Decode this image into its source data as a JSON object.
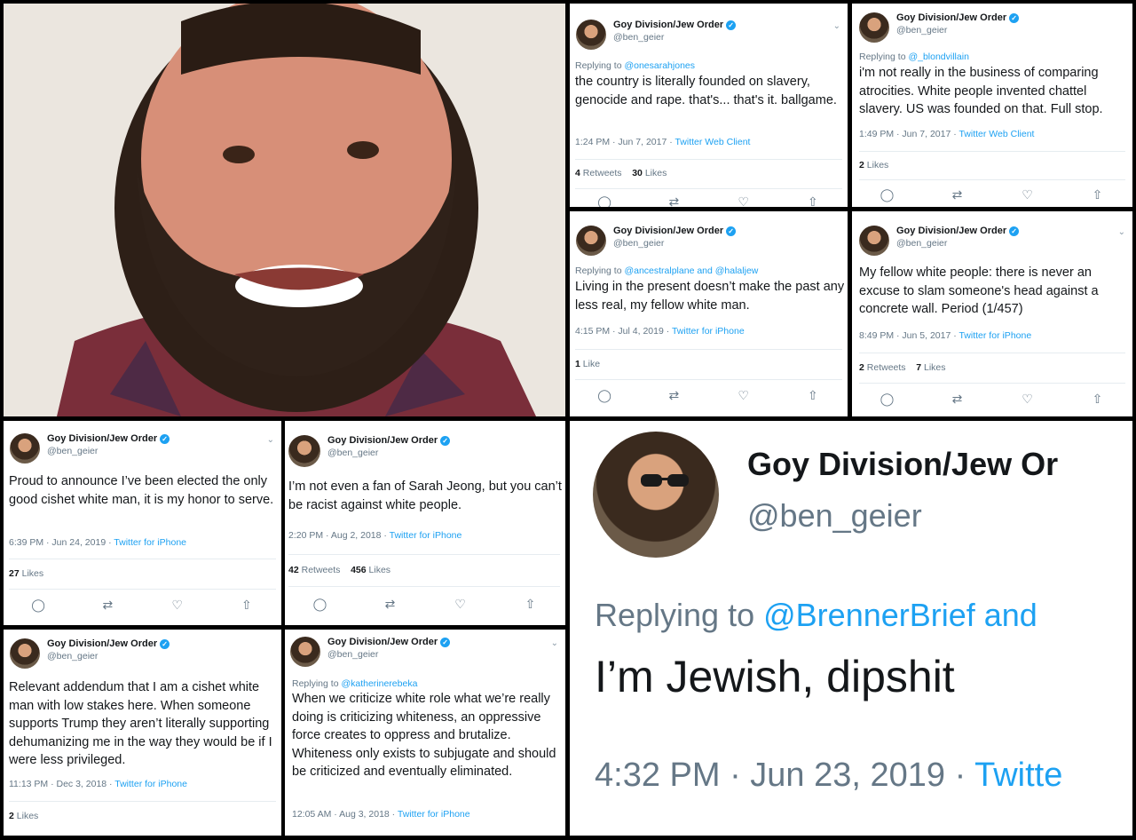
{
  "account": {
    "display_name": "Goy Division/Jew Order",
    "handle": "@ben_geier",
    "verified_glyph": "✓"
  },
  "icons": {
    "reply": "comment-bubble-icon",
    "retweet": "retweet-icon",
    "like": "heart-icon",
    "share": "share-icon",
    "more": "chevron-down-icon"
  },
  "tweets": [
    {
      "replying_label": "Replying to",
      "replying_to": "@onesarahjones",
      "text": "the country is literally founded on slavery, genocide and rape. that's... that's it. ballgame.",
      "time": "1:24 PM · Jun 7, 2017 · ",
      "source": "Twitter Web Client",
      "retweets": "4",
      "retweets_label": "Retweets",
      "likes": "30",
      "likes_label": "Likes"
    },
    {
      "replying_label": "Replying to",
      "replying_to": "@_blondvillain",
      "text": "i'm not really in the business of comparing atrocities. White people invented chattel slavery. US was founded on that. Full stop.",
      "time": "1:49 PM · Jun 7, 2017 · ",
      "source": "Twitter Web Client",
      "likes": "2",
      "likes_label": "Likes"
    },
    {
      "replying_label": "Replying to",
      "replying_to": "@ancestralplane and @halaljew",
      "text": "Living in the present doesn’t make the past any less real, my fellow white man.",
      "time": "4:15 PM · Jul 4, 2019 · ",
      "source": "Twitter for iPhone",
      "likes": "1",
      "likes_label": "Like"
    },
    {
      "text": "My fellow white people: there is never an excuse to slam someone's head against a concrete wall. Period (1/457)",
      "time": "8:49 PM · Jun 5, 2017 · ",
      "source": "Twitter for iPhone",
      "retweets": "2",
      "retweets_label": "Retweets",
      "likes": "7",
      "likes_label": "Likes"
    },
    {
      "text": "Proud to announce I’ve been elected the only good cishet white man, it is my honor to serve.",
      "time": "6:39 PM · Jun 24, 2019 · ",
      "source": "Twitter for iPhone",
      "likes": "27",
      "likes_label": "Likes"
    },
    {
      "text": "I’m not even a fan of Sarah Jeong, but you can’t be racist against white people.",
      "time": "2:20 PM · Aug 2, 2018 · ",
      "source": "Twitter for iPhone",
      "retweets": "42",
      "retweets_label": "Retweets",
      "likes": "456",
      "likes_label": "Likes"
    },
    {
      "text": "Relevant addendum that I am a cishet white man with low stakes here. When someone supports Trump they aren’t literally supporting dehumanizing me in the way they would be if I were less privileged.",
      "time": "11:13 PM · Dec 3, 2018 · ",
      "source": "Twitter for iPhone",
      "likes": "2",
      "likes_label": "Likes"
    },
    {
      "replying_label": "Replying to",
      "replying_to": "@katherinerebeka",
      "text": "When we criticize white role what we’re really doing is criticizing whiteness, an oppressive force creates to oppress and brutalize. Whiteness only exists to subjugate and should be criticized and eventually eliminated.",
      "time": "12:05 AM · Aug 3, 2018 · ",
      "source": "Twitter for iPhone"
    },
    {
      "display_name": "Goy Division/Jew Or",
      "replying_label": "Replying to",
      "replying_to": "@BrennerBrief and",
      "text": "I’m Jewish, dipshit",
      "time": "4:32 PM · Jun 23, 2019 · ",
      "source": "Twitte"
    }
  ]
}
